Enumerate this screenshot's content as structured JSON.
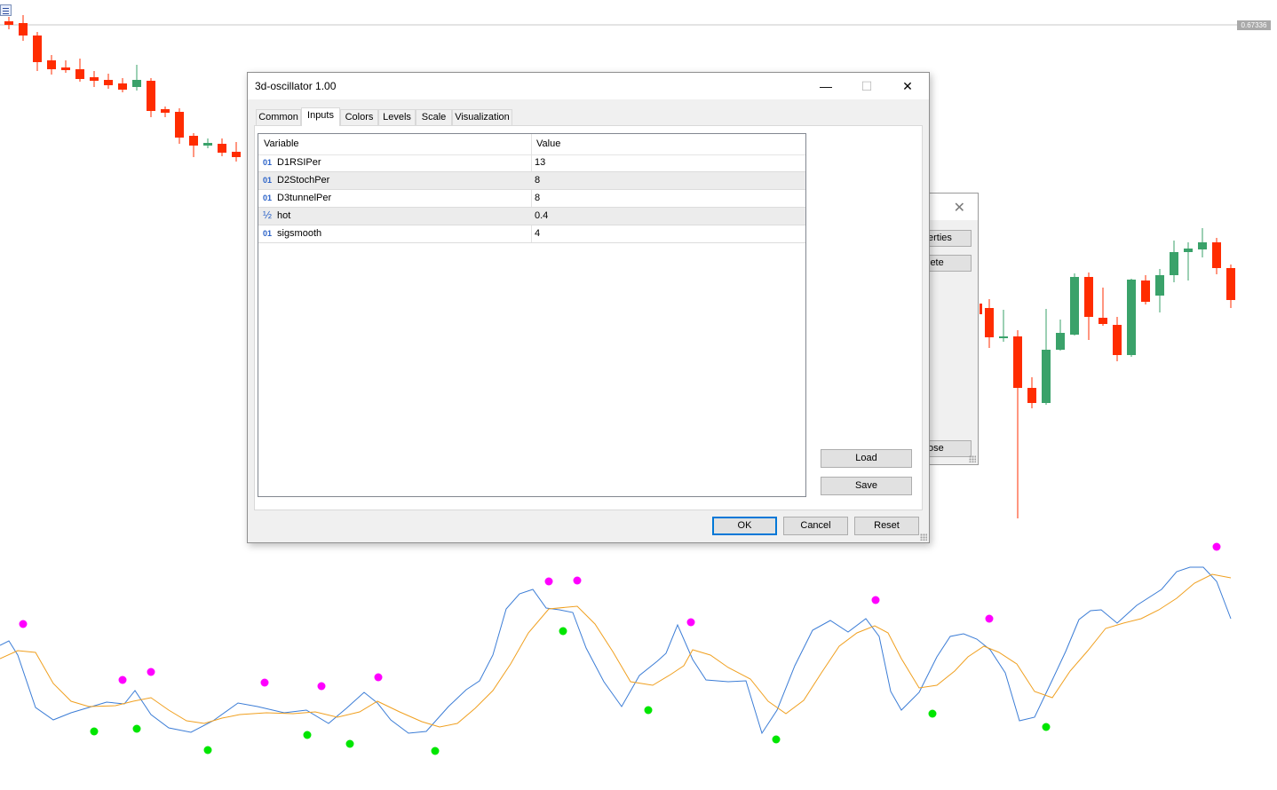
{
  "chart": {
    "price_label": "0.67336",
    "colors": {
      "bear": "#ff2c00",
      "bull": "#3aa26a",
      "fast_line": "#3c7dd6",
      "slow_line": "#f0a020",
      "upper_dot": "#ff00ff",
      "lower_dot": "#00e600"
    }
  },
  "background_dialog": {
    "close_glyph": "✕",
    "properties_label": "erties",
    "delete_label": "lete",
    "close_label": "ose"
  },
  "dialog": {
    "title": "3d-oscillator 1.00",
    "window_buttons": {
      "minimize": "—",
      "maximize": "☐",
      "close": "✕"
    },
    "tabs": [
      "Common",
      "Inputs",
      "Colors",
      "Levels",
      "Scale",
      "Visualization"
    ],
    "active_tab": "Inputs",
    "grid": {
      "columns": [
        "Variable",
        "Value"
      ],
      "rows": [
        {
          "type": "01",
          "name": "D1RSIPer",
          "value": "13"
        },
        {
          "type": "01",
          "name": "D2StochPer",
          "value": "8"
        },
        {
          "type": "01",
          "name": "D3tunnelPer",
          "value": "8"
        },
        {
          "type": "½",
          "name": "hot",
          "value": "0.4"
        },
        {
          "type": "01",
          "name": "sigsmooth",
          "value": "4"
        }
      ]
    },
    "side_buttons": {
      "load": "Load",
      "save": "Save"
    },
    "footer_buttons": {
      "ok": "OK",
      "cancel": "Cancel",
      "reset": "Reset"
    }
  }
}
